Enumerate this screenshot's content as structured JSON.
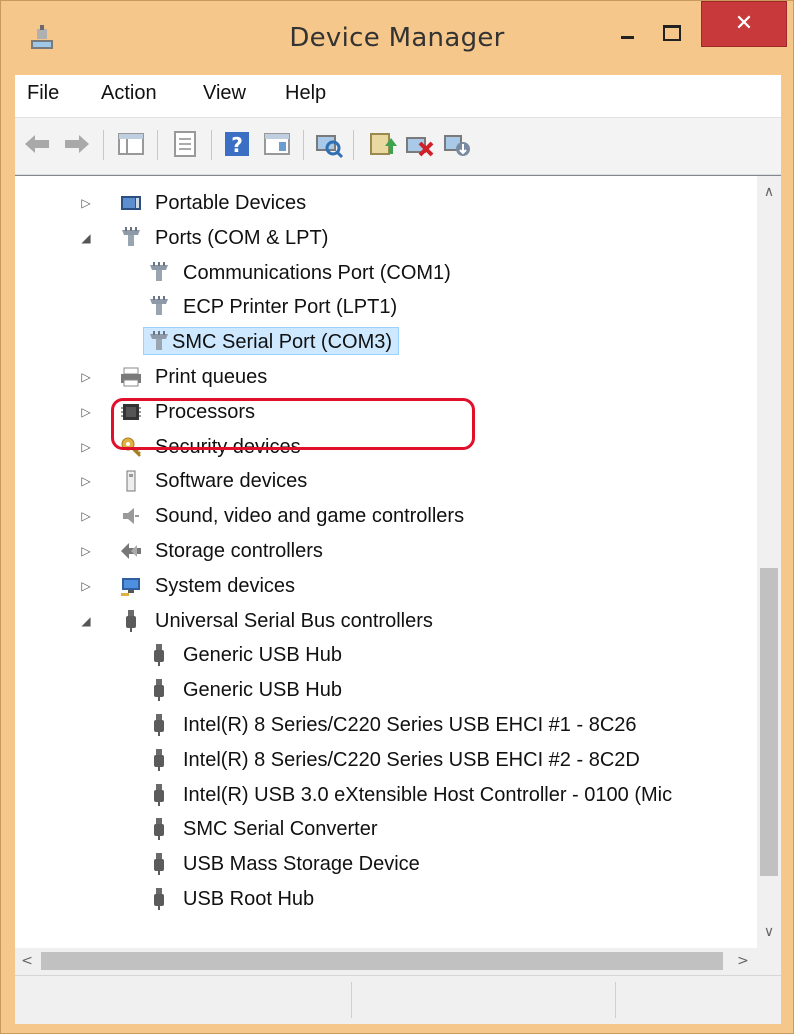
{
  "window": {
    "title": "Device Manager",
    "close_glyph": "✕"
  },
  "menubar": {
    "items": [
      "File",
      "Action",
      "View",
      "Help"
    ]
  },
  "toolbar": {
    "buttons": [
      "back-icon",
      "forward-icon",
      "show-hide-console-tree-icon",
      "properties-icon",
      "help-icon",
      "action-pane-icon",
      "scan-hardware-icon",
      "update-driver-icon",
      "uninstall-device-icon",
      "disable-device-icon"
    ]
  },
  "tree": {
    "nodes": [
      {
        "label": "Portable Devices",
        "state": "collapsed",
        "icon": "portable-devices-icon"
      },
      {
        "label": "Ports (COM & LPT)",
        "state": "expanded",
        "icon": "port-connector-icon"
      },
      {
        "label": "Communications Port (COM1)",
        "icon": "port-connector-icon"
      },
      {
        "label": "ECP Printer Port (LPT1)",
        "icon": "port-connector-icon"
      },
      {
        "label": "SMC Serial Port (COM3)",
        "icon": "port-connector-icon",
        "selected": true
      },
      {
        "label": "Print queues",
        "state": "collapsed",
        "icon": "printer-icon"
      },
      {
        "label": "Processors",
        "state": "collapsed",
        "icon": "processor-icon"
      },
      {
        "label": "Security devices",
        "state": "collapsed",
        "icon": "security-key-icon"
      },
      {
        "label": "Software devices",
        "state": "collapsed",
        "icon": "software-device-icon"
      },
      {
        "label": "Sound, video and game controllers",
        "state": "collapsed",
        "icon": "speaker-icon"
      },
      {
        "label": "Storage controllers",
        "state": "collapsed",
        "icon": "storage-controller-icon"
      },
      {
        "label": "System devices",
        "state": "collapsed",
        "icon": "system-devices-icon"
      },
      {
        "label": "Universal Serial Bus controllers",
        "state": "expanded",
        "icon": "usb-plug-icon"
      },
      {
        "label": "Generic USB Hub",
        "icon": "usb-plug-icon"
      },
      {
        "label": "Generic USB Hub",
        "icon": "usb-plug-icon"
      },
      {
        "label": "Intel(R) 8 Series/C220 Series USB EHCI #1 - 8C26",
        "icon": "usb-plug-icon"
      },
      {
        "label": "Intel(R) 8 Series/C220 Series USB EHCI #2 - 8C2D",
        "icon": "usb-plug-icon"
      },
      {
        "label": "Intel(R) USB 3.0 eXtensible Host Controller - 0100 (Mic",
        "icon": "usb-plug-icon"
      },
      {
        "label": "SMC Serial Converter",
        "icon": "usb-plug-icon"
      },
      {
        "label": "USB Mass Storage Device",
        "icon": "usb-plug-icon"
      },
      {
        "label": "USB Root Hub",
        "icon": "usb-plug-icon"
      }
    ]
  },
  "scrollbars": {
    "up": "∧",
    "down": "∨",
    "left": "<",
    "right": ">"
  },
  "colors": {
    "frame": "#f5c78a",
    "close": "#c7393a",
    "selection": "#cde8ff",
    "highlight": "#e0102a"
  }
}
